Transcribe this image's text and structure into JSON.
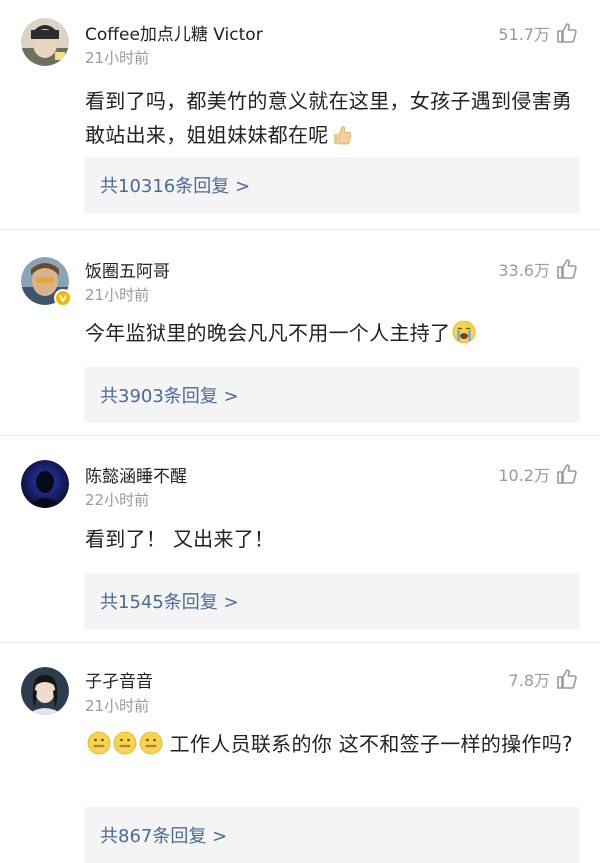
{
  "comments": [
    {
      "username": "Coffee加点儿糖 Victor",
      "time": "21小时前",
      "likes": "51.7万",
      "text": "看到了吗，都美竹的意义就在这里，女孩子遇到侵害勇敢站出来，姐姐妹妹都在呢",
      "trailing_emoji": "thumbs-up",
      "replies": "共10316条回复 >",
      "verified": false
    },
    {
      "username": "饭圈五阿哥",
      "time": "21小时前",
      "likes": "33.6万",
      "text": "今年监狱里的晚会凡凡不用一个人主持了",
      "trailing_emoji": "crying-face",
      "replies": "共3903条回复 >",
      "verified": true
    },
    {
      "username": "陈懿涵睡不醒",
      "time": "22小时前",
      "likes": "10.2万",
      "text": "看到了！ 又出来了！",
      "trailing_emoji": "",
      "replies": "共1545条回复 >",
      "verified": false
    },
    {
      "username": "子孑音音",
      "time": "21小时前",
      "likes": "7.8万",
      "text": "工作人员联系的你 这不和签子一样的操作吗?",
      "leading_emoji": "zipper-mouth-face x3",
      "replies": "共867条回复 >",
      "verified": false
    }
  ],
  "icons": {
    "like": "thumbs-up-outline-icon",
    "verified": "verified-badge-icon"
  },
  "colors": {
    "reply_link": "#4a6a99",
    "meta_gray": "#9a9a9a",
    "reply_bg": "#f4f4f4",
    "verified_badge": "#f5b700"
  }
}
